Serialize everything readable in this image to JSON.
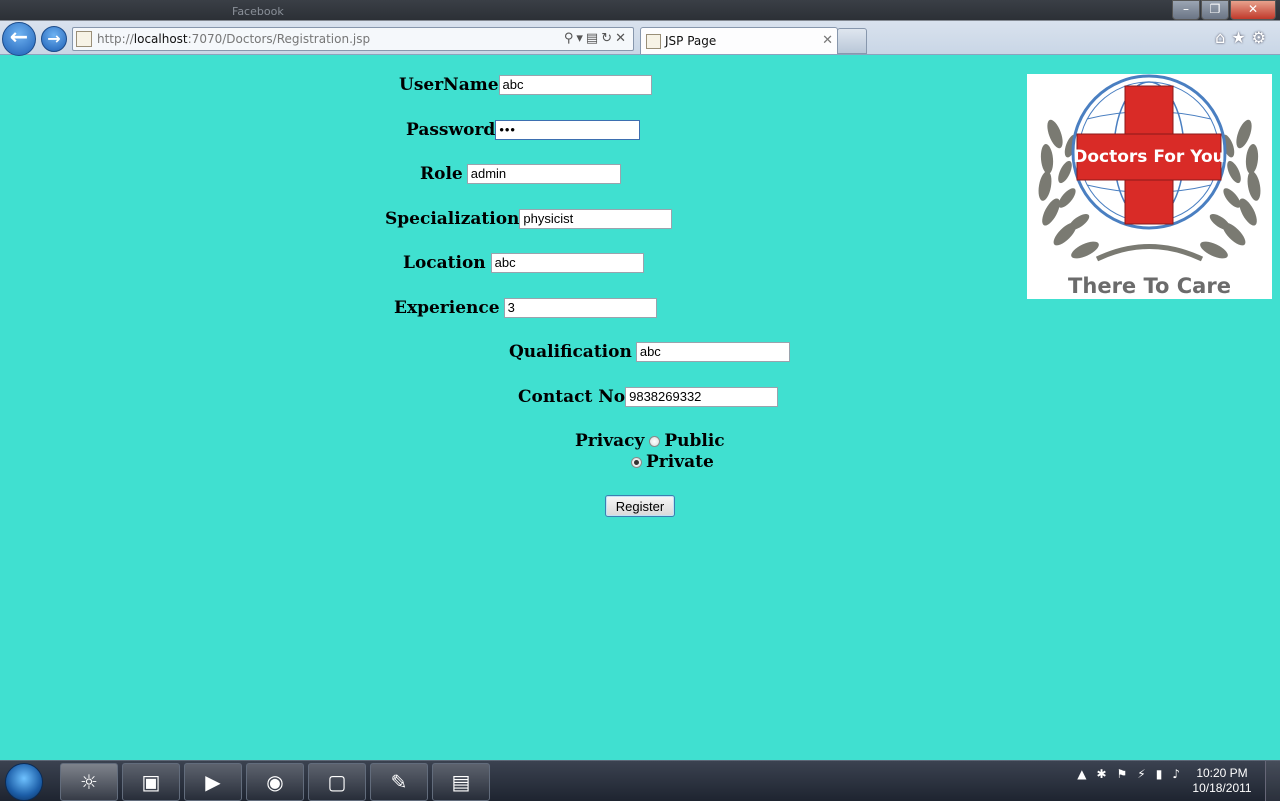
{
  "browser": {
    "background_tabs": [
      "Facebook"
    ],
    "url_prefix": "http://",
    "url_host": "localhost",
    "url_path": ":7070/Doctors/Registration.jsp",
    "tab_title": "JSP Page",
    "window_controls": [
      "minimize-icon",
      "maximize-icon",
      "close-icon"
    ],
    "right_icons": [
      "home-icon",
      "star-icon",
      "gear-icon"
    ]
  },
  "form": {
    "username_label": "UserName",
    "username_value": "abc",
    "password_label": "Password",
    "password_value": "•••",
    "role_label": "Role",
    "role_value": "admin",
    "specialization_label": "Specialization",
    "specialization_value": "physicist",
    "location_label": "Location",
    "location_value": "abc",
    "experience_label": "Experience",
    "experience_value": "3",
    "qualification_label": "Qualification",
    "qualification_value": "abc",
    "contact_label": "Contact No",
    "contact_value": "9838269332",
    "privacy_label": "Privacy",
    "privacy_options": [
      "Public",
      "Private"
    ],
    "privacy_selected": "Private",
    "register_label": "Register"
  },
  "logo": {
    "banner_text": "Doctors For You",
    "caption": "There To Care"
  },
  "taskbar": {
    "apps": [
      "internet-explorer-icon",
      "folder-icon",
      "media-player-icon",
      "chrome-icon",
      "virtualbox-icon",
      "paint-icon",
      "document-window-icon"
    ],
    "tray_icons": [
      "show-hidden-icon",
      "bluetooth-icon",
      "action-center-icon",
      "power-icon",
      "signal-icon",
      "volume-icon"
    ],
    "time": "10:20 PM",
    "date": "10/18/2011"
  },
  "colors": {
    "page_background": "#40e0d0",
    "logo_cross_red": "#d92b27",
    "logo_laurel_gray": "#7a7a72"
  }
}
